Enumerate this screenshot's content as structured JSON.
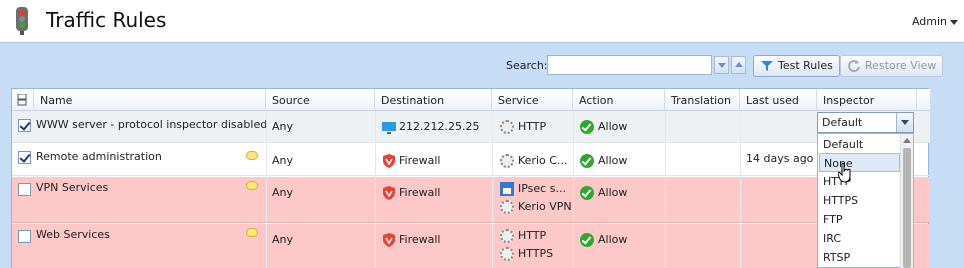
{
  "header": {
    "title": "Traffic Rules",
    "user_menu": "Admin"
  },
  "toolbar": {
    "search_label": "Search:",
    "search_value": "",
    "test_rules_label": "Test Rules",
    "restore_view_label": "Restore View"
  },
  "columns": [
    "Name",
    "Source",
    "Destination",
    "Service",
    "Action",
    "Translation",
    "Last used",
    "Inspector"
  ],
  "rows": [
    {
      "name": "WWW server - protocol inspector disabled",
      "source": "Any",
      "destination": "212.212.25.25",
      "services": [
        "HTTP"
      ],
      "action": "Allow",
      "last_used": "",
      "checked": true
    },
    {
      "name": "Remote administration",
      "source": "Any",
      "destination": "Firewall",
      "services": [
        "Kerio C..."
      ],
      "action": "Allow",
      "last_used": "14 days ago",
      "checked": true
    },
    {
      "name": "VPN Services",
      "source": "Any",
      "destination": "Firewall",
      "services": [
        "IPsec s...",
        "Kerio VPN"
      ],
      "action": "Allow",
      "last_used": "",
      "checked": false
    },
    {
      "name": "Web Services",
      "source": "Any",
      "destination": "Firewall",
      "services": [
        "HTTP",
        "HTTPS"
      ],
      "action": "Allow",
      "last_used": "",
      "checked": false
    }
  ],
  "inspector": {
    "selected": "Default",
    "options": [
      "Default",
      "None",
      "HTTP",
      "HTTPS",
      "FTP",
      "IRC",
      "RTSP"
    ],
    "hovered": "None"
  },
  "colors": {
    "disabled_row": "#fcc8c8",
    "allow": "#2fa82f",
    "firewall": "#e2463b",
    "header_bg": "#c7dcf5"
  }
}
